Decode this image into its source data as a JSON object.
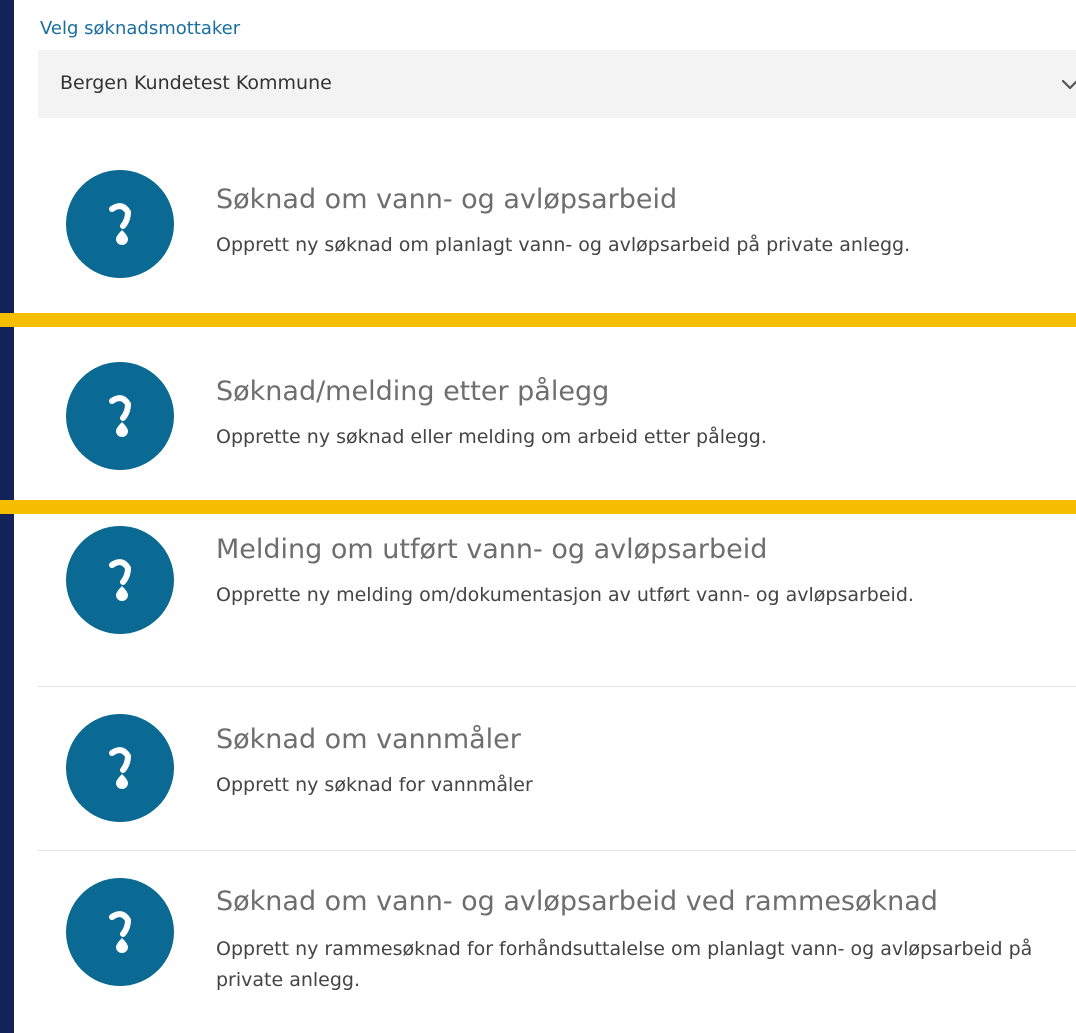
{
  "receiver": {
    "label": "Velg søknadsmottaker",
    "selected": "Bergen Kundetest Kommune"
  },
  "items": [
    {
      "title": "Søknad om vann- og avløpsarbeid",
      "description": "Opprett ny søknad om planlagt vann- og avløpsarbeid på private anlegg.",
      "icon": "water-drop-icon"
    },
    {
      "title": "Søknad/melding etter pålegg",
      "description": "Opprette ny søknad eller melding om arbeid etter pålegg.",
      "icon": "water-drop-icon"
    },
    {
      "title": "Melding om utført vann- og avløpsarbeid",
      "description": "Opprette ny melding om/dokumentasjon av utført vann- og avløpsarbeid.",
      "icon": "water-drop-icon"
    },
    {
      "title": "Søknad om vannmåler",
      "description": "Opprett ny søknad for vannmåler",
      "icon": "water-drop-icon"
    },
    {
      "title": "Søknad om vann- og avløpsarbeid ved rammesøknad",
      "description": "Opprett ny rammesøknad for forhåndsuttalelse om planlagt vann- og avløpsarbeid på private anlegg.",
      "icon": "water-drop-icon"
    }
  ],
  "colors": {
    "frame": "#13235a",
    "accent": "#0b6a94",
    "highlight": "#f6be00",
    "label": "#1a6ea0"
  }
}
